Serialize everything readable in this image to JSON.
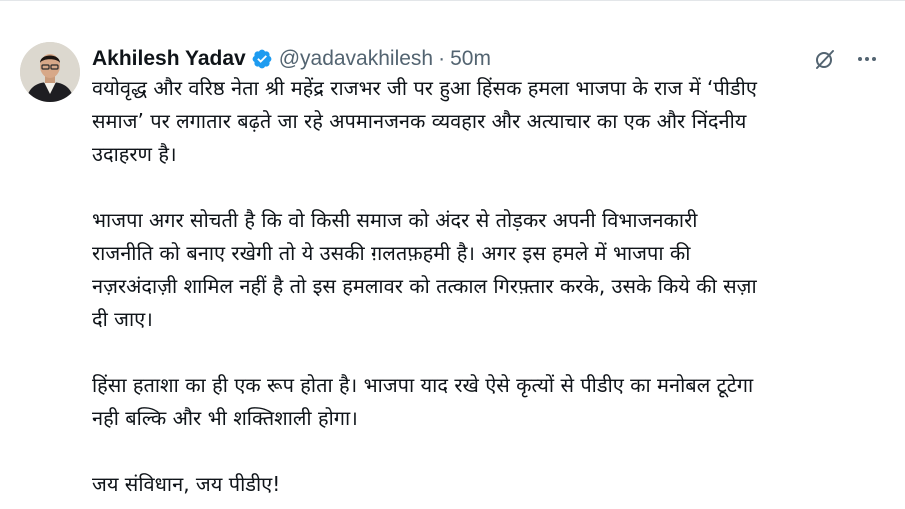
{
  "tweet": {
    "author_name": "Akhilesh Yadav",
    "handle": "@yadavakhilesh",
    "separator": "·",
    "time": "50m",
    "verified": true,
    "accent_color": "#1d9bf0",
    "icons": {
      "verified": "verified-badge-icon",
      "grok": "grok-icon",
      "more": "more-options-icon"
    },
    "body_lines": [
      [
        "वयोवृद्ध और वरिष्ठ नेता श्री महेंद्र राजभर जी पर हुआ हिंसक हमला भाजपा के राज में ‘पीडीए",
        "समाज’ पर लगातार बढ़ते जा रहे अपमानजनक व्यवहार और अत्याचार का एक और निंदनीय",
        "उदाहरण है।"
      ],
      [
        "भाजपा अगर सोचती है कि वो किसी समाज को अंदर से तोड़कर अपनी विभाजनकारी",
        "राजनीति को बनाए रखेगी तो ये उसकी ग़लतफ़हमी है। अगर इस हमले में भाजपा की",
        "नज़रअंदाज़ी शामिल नहीं है तो इस हमलावर को तत्काल गिरफ़्तार करके, उसके किये की सज़ा",
        "दी जाए।"
      ],
      [
        "हिंसा हताशा का ही एक रूप होता है। भाजपा याद रखे ऐसे कृत्यों से पीडीए का मनोबल टूटेगा",
        "नही बल्कि और भी शक्तिशाली होगा।"
      ],
      [
        "जय संविधान, जय पीडीए!"
      ]
    ]
  }
}
